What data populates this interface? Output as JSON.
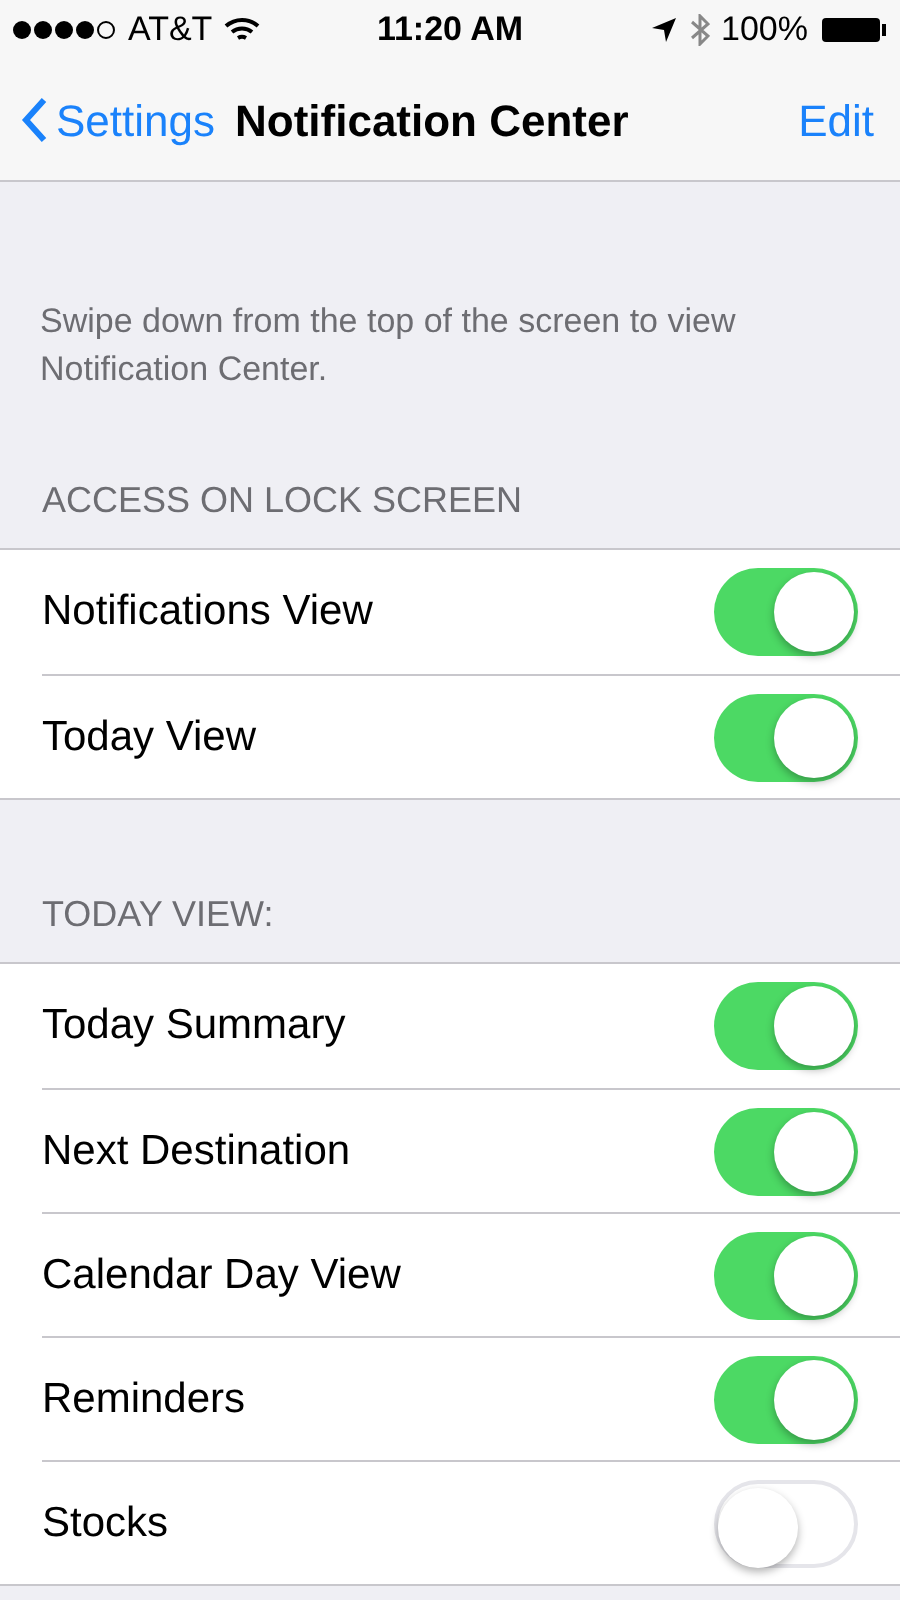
{
  "status_bar": {
    "carrier": "AT&T",
    "time": "11:20 AM",
    "battery": "100%"
  },
  "nav": {
    "back": "Settings",
    "title": "Notification Center",
    "action": "Edit"
  },
  "description": "Swipe down from the top of the screen to view Notification Center.",
  "sections": [
    {
      "header": "ACCESS ON LOCK SCREEN",
      "items": [
        {
          "label": "Notifications View",
          "on": true
        },
        {
          "label": "Today View",
          "on": true
        }
      ]
    },
    {
      "header": "TODAY VIEW:",
      "items": [
        {
          "label": "Today Summary",
          "on": true
        },
        {
          "label": "Next Destination",
          "on": true
        },
        {
          "label": "Calendar Day View",
          "on": true
        },
        {
          "label": "Reminders",
          "on": true
        },
        {
          "label": "Stocks",
          "on": false
        }
      ]
    }
  ]
}
